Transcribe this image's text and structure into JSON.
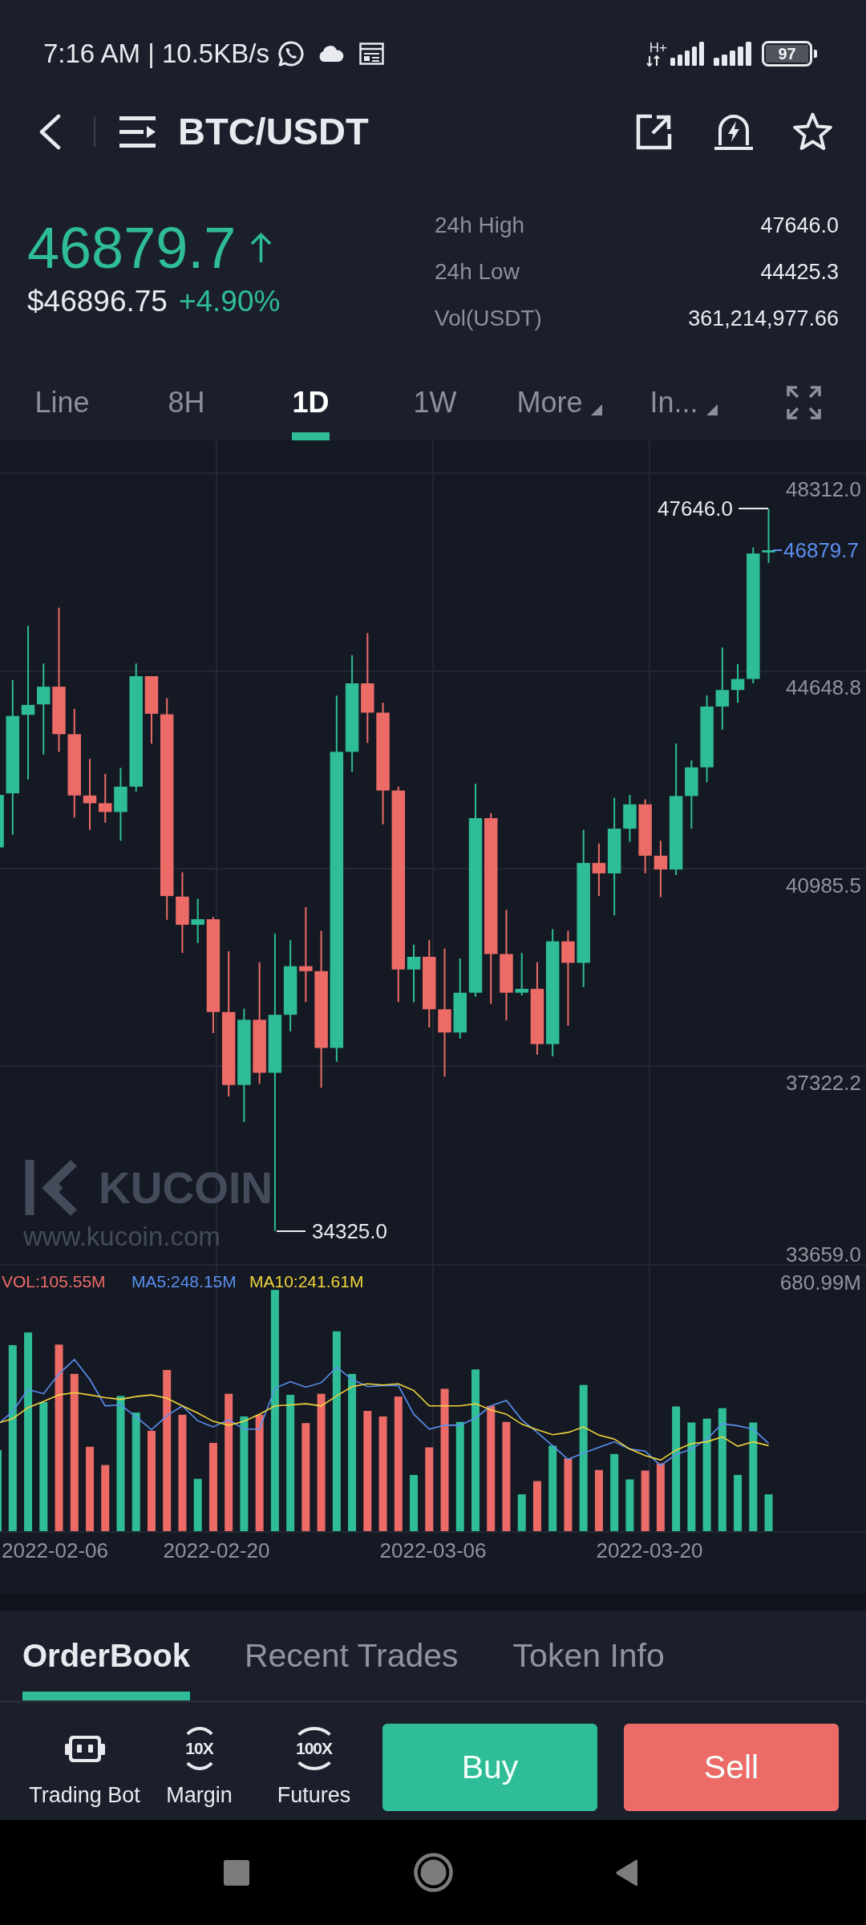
{
  "status_bar": {
    "time_and_speed": "7:16 AM | 10.5KB/s",
    "network_type": "H+",
    "battery": "97"
  },
  "header": {
    "pair": "BTC/USDT"
  },
  "price": {
    "last": "46879.7",
    "usd_value": "$46896.75",
    "change": "+4.90%"
  },
  "stats": [
    {
      "label": "24h High",
      "value": "47646.0"
    },
    {
      "label": "24h Low",
      "value": "44425.3"
    },
    {
      "label": "Vol(USDT)",
      "value": "361,214,977.66"
    }
  ],
  "intervals": [
    {
      "label": "Line",
      "kind": "period",
      "selected": false
    },
    {
      "label": "8H",
      "kind": "period",
      "selected": false
    },
    {
      "label": "1D",
      "kind": "period",
      "selected": true
    },
    {
      "label": "1W",
      "kind": "period",
      "selected": false
    },
    {
      "label": "More",
      "kind": "dropdown",
      "selected": false
    },
    {
      "label": "In...",
      "kind": "dropdown",
      "selected": false
    }
  ],
  "chart": {
    "price_ticks": [
      "48312.0",
      "44648.8",
      "40985.5",
      "37322.2",
      "33659.0"
    ],
    "high_marker": "47646.0",
    "last_price": "46879.7",
    "low_marker": "34325.0",
    "watermark": {
      "brand": "KUCOIN",
      "url": "www.kucoin.com"
    },
    "volume_legend": [
      {
        "label": "VOL:105.55M",
        "color": "#ec6b67"
      },
      {
        "label": "MA5:248.15M",
        "color": "#5b8ff0"
      },
      {
        "label": "MA10:241.61M",
        "color": "#f0d43a"
      }
    ],
    "volume_max": "680.99M",
    "dates": [
      "2022-02-06",
      "2022-02-20",
      "2022-03-06",
      "2022-03-20"
    ]
  },
  "bottom_tabs": [
    {
      "label": "OrderBook",
      "selected": true
    },
    {
      "label": "Recent Trades",
      "selected": false
    },
    {
      "label": "Token Info",
      "selected": false
    }
  ],
  "shortcuts": [
    {
      "label": "Trading Bot",
      "kind": "bot"
    },
    {
      "label": "Margin",
      "kind": "badge",
      "badge": "10X"
    },
    {
      "label": "Futures",
      "kind": "badge",
      "badge": "100X"
    }
  ],
  "actions": [
    {
      "label": "Buy",
      "kind": "buy"
    },
    {
      "label": "Sell",
      "kind": "sell"
    }
  ]
}
